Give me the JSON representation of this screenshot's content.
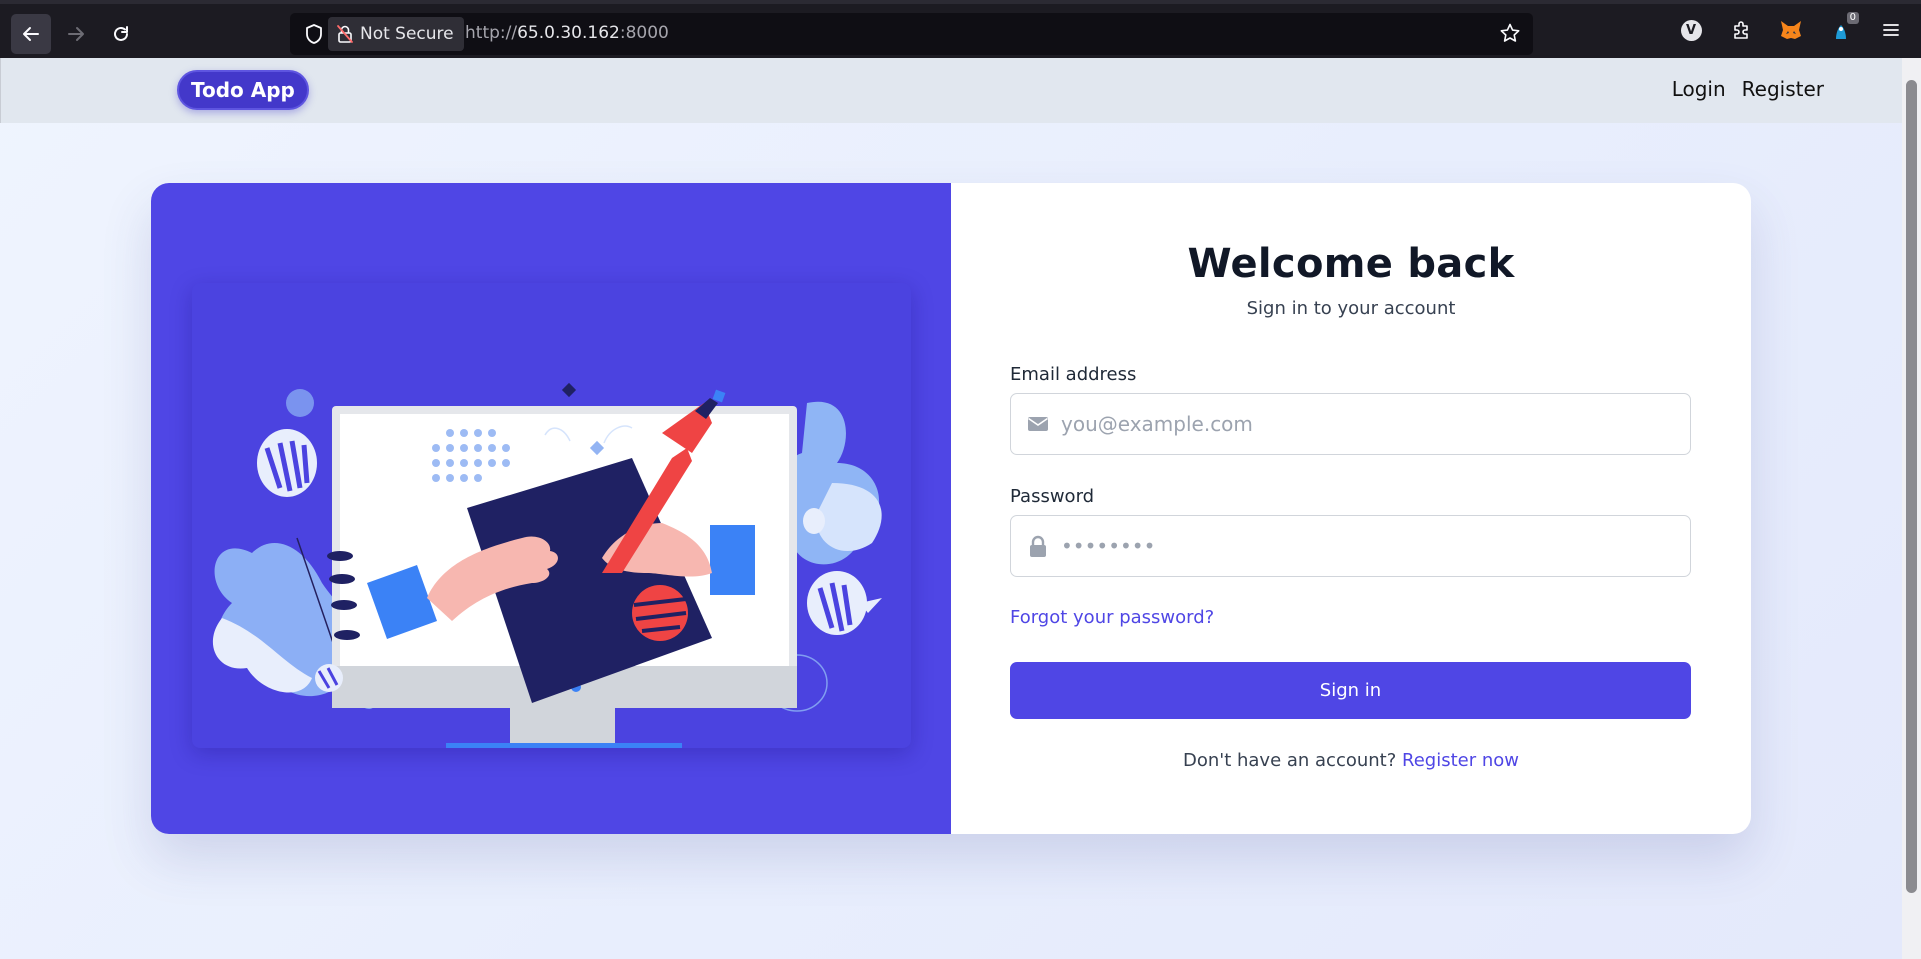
{
  "browser": {
    "security_label": "Not Secure",
    "url_prefix": "http://",
    "url_host": "65.0.30.162",
    "url_port": ":8000",
    "extension_badge_count": "0",
    "vpn_letter": "V",
    "icons": [
      "back-arrow-icon",
      "forward-arrow-icon",
      "reload-icon",
      "shield-icon",
      "lock-slash-icon",
      "star-icon",
      "vpn-icon",
      "extensions-icon",
      "fox-extension-icon",
      "blue-extension-icon",
      "menu-icon"
    ]
  },
  "header": {
    "brand": "Todo App",
    "nav": {
      "login": "Login",
      "register": "Register"
    }
  },
  "login_form": {
    "title": "Welcome back",
    "subtitle": "Sign in to your account",
    "email_label": "Email address",
    "email_placeholder": "you@example.com",
    "password_label": "Password",
    "password_placeholder": "••••••••",
    "forgot_link": "Forgot your password?",
    "submit_label": "Sign in",
    "register_prompt": "Don't have an account?",
    "register_link": "Register now"
  },
  "colors": {
    "accent": "#4f46e5",
    "brand_pill": "#4338ca",
    "header_bg": "#e1e7ef",
    "heading": "#111827"
  }
}
